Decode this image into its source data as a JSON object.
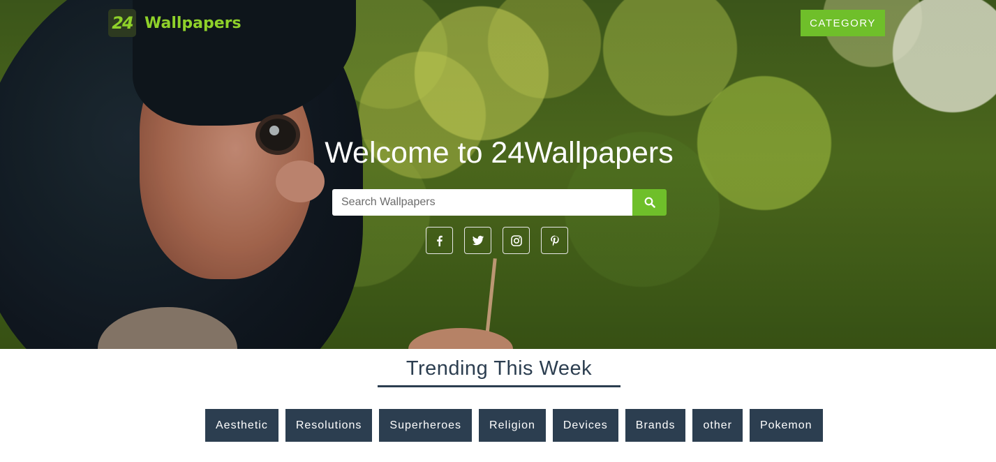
{
  "header": {
    "logo_badge": "24",
    "logo_text": "Wallpapers",
    "category_label": "CATEGORY",
    "brand_color": "#6fbf2a"
  },
  "hero": {
    "title": "Welcome to 24Wallpapers",
    "search_placeholder": "Search Wallpapers",
    "search_icon": "search-icon",
    "socials": [
      "facebook-icon",
      "twitter-icon",
      "instagram-icon",
      "pinterest-icon"
    ]
  },
  "trending": {
    "title": "Trending This Week",
    "tags": [
      "Aesthetic",
      "Resolutions",
      "Superheroes",
      "Religion",
      "Devices",
      "Brands",
      "other",
      "Pokemon"
    ],
    "tag_color": "#2c3e50"
  }
}
